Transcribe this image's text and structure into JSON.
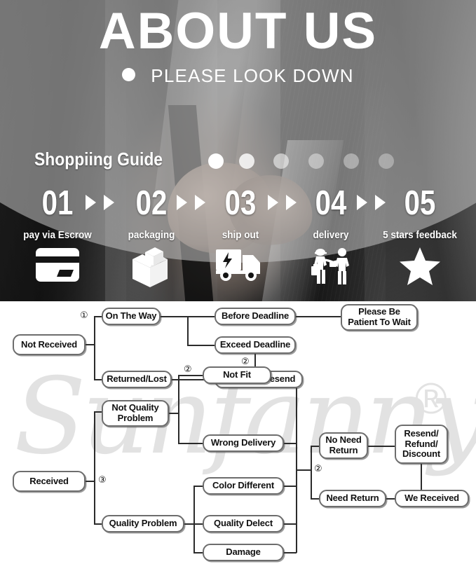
{
  "hero": {
    "title": "ABOUT US",
    "subtitle": "PLEASE LOOK DOWN",
    "bullet_icon": "dot-icon"
  },
  "guide": {
    "heading": "Shoppiing Guide",
    "dots": [
      "dot-1",
      "dot-2",
      "dot-3",
      "dot-4",
      "dot-5",
      "dot-6"
    ],
    "numbers": [
      "01",
      "02",
      "03",
      "04",
      "05"
    ],
    "arrow_icon": "double-arrow-icon",
    "steps": [
      {
        "number": "01",
        "label": "pay via Escrow",
        "icon": "credit-card-icon"
      },
      {
        "number": "02",
        "label": "packaging",
        "icon": "package-box-icon"
      },
      {
        "number": "03",
        "label": "ship out",
        "icon": "delivery-truck-icon"
      },
      {
        "number": "04",
        "label": "delivery",
        "icon": "handover-people-icon"
      },
      {
        "number": "05",
        "label": "5 stars feedback",
        "icon": "star-icon"
      }
    ]
  },
  "watermark": {
    "text": "Sunfanny",
    "registered_mark": "®"
  },
  "flowchart": {
    "markers": {
      "one": "①",
      "two": "②",
      "three": "③"
    },
    "nodes": {
      "not_received": "Not Received",
      "on_the_way": "On The Way",
      "returned_lost": "Returned/Lost",
      "before_deadline": "Before Deadline",
      "exceed_deadline": "Exceed Deadline",
      "returned_resend": "Returned/Resend",
      "please_be_patient": "Please Be\nPatient To Wait",
      "received": "Received",
      "not_quality_problem": "Not Quality\nProblem",
      "quality_problem": "Quality Problem",
      "not_fit": "Not Fit",
      "wrong_delivery": "Wrong Delivery",
      "color_different": "Color Different",
      "quality_delect": "Quality Delect",
      "damage": "Damage",
      "no_need_return": "No Need\nReturn",
      "need_return": "Need Return",
      "resend_refund_discount": "Resend/\nRefund/\nDiscount",
      "we_received": "We Received"
    },
    "marker_labels": {
      "m1_on_the_way": "①",
      "m2_returned_lost": "②",
      "m2_exceed": "②",
      "m3_received": "③",
      "m2_return_branch": "②"
    }
  },
  "colors": {
    "hero_bg": "#141414",
    "ellipse_overlay": "#c5c5c5",
    "node_border": "#6d6d6d",
    "line": "#2b2b2b",
    "watermark": "#e2e2e2",
    "white": "#ffffff"
  }
}
